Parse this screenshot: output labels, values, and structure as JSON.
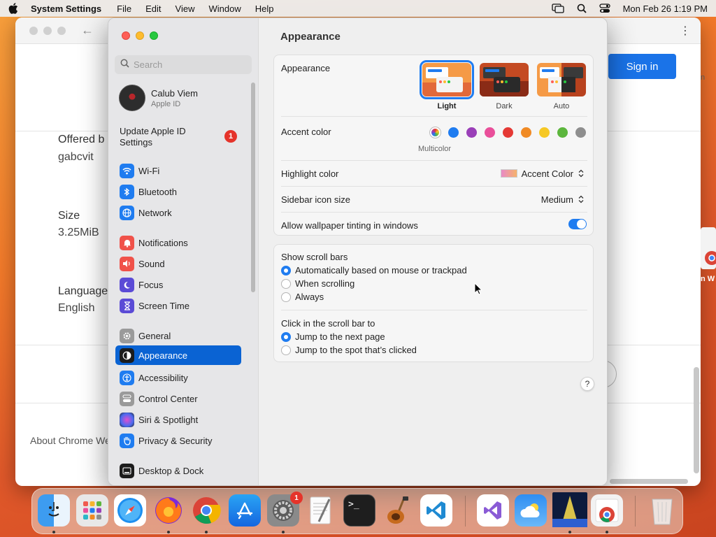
{
  "menubar": {
    "app_name": "System Settings",
    "menus": [
      "File",
      "Edit",
      "View",
      "Window",
      "Help"
    ],
    "datetime": "Mon Feb 26  1:19 PM"
  },
  "chrome": {
    "sign_in_label": "Sign in",
    "offered_by_label": "Offered b",
    "offered_by_value": "gabcvit",
    "size_label": "Size",
    "size_value": "3.25MiB",
    "language_label": "Language",
    "language_value": "English",
    "about_link": "About Chrome We",
    "side_text": "n W",
    "side_text_top": "n"
  },
  "sidebar": {
    "search_placeholder": "Search",
    "account_name": "Calub Viem",
    "account_sub": "Apple ID",
    "update_label": "Update Apple ID Settings",
    "update_badge": "1",
    "items": [
      {
        "label": "Wi-Fi"
      },
      {
        "label": "Bluetooth"
      },
      {
        "label": "Network"
      },
      {
        "label": "Notifications"
      },
      {
        "label": "Sound"
      },
      {
        "label": "Focus"
      },
      {
        "label": "Screen Time"
      },
      {
        "label": "General"
      },
      {
        "label": "Appearance"
      },
      {
        "label": "Accessibility"
      },
      {
        "label": "Control Center"
      },
      {
        "label": "Siri & Spotlight"
      },
      {
        "label": "Privacy & Security"
      },
      {
        "label": "Desktop & Dock"
      }
    ],
    "selected": "Appearance"
  },
  "main": {
    "title": "Appearance",
    "appearance_label": "Appearance",
    "appearance_options": [
      "Light",
      "Dark",
      "Auto"
    ],
    "appearance_selected": "Light",
    "accent_label": "Accent color",
    "accent_colors": [
      "multicolor",
      "#1f7cf0",
      "#9a3fb8",
      "#e94f9a",
      "#e53935",
      "#f08a24",
      "#f6c824",
      "#5cb63d",
      "#8e8e8e"
    ],
    "accent_selected_label": "Multicolor",
    "highlight_label": "Highlight color",
    "highlight_value": "Accent Color",
    "icon_size_label": "Sidebar icon size",
    "icon_size_value": "Medium",
    "tinting_label": "Allow wallpaper tinting in windows",
    "tinting_on": true,
    "scrollbars_label": "Show scroll bars",
    "scrollbar_options": [
      "Automatically based on mouse or trackpad",
      "When scrolling",
      "Always"
    ],
    "click_label": "Click in the scroll bar to",
    "click_options": [
      "Jump to the next page",
      "Jump to the spot that’s clicked"
    ],
    "help_label": "?"
  },
  "dock": {
    "settings_badge": "1",
    "apps": [
      "finder-icon",
      "launchpad-icon",
      "safari-icon",
      "firefox-icon",
      "chrome-icon",
      "app-store-icon",
      "system-settings-icon",
      "textedit-icon",
      "terminal-icon",
      "instruments-icon",
      "vscode-icon",
      "visual-studio-icon",
      "weather-icon",
      "image-icon",
      "chrome-installer-icon",
      "trash-icon"
    ]
  }
}
